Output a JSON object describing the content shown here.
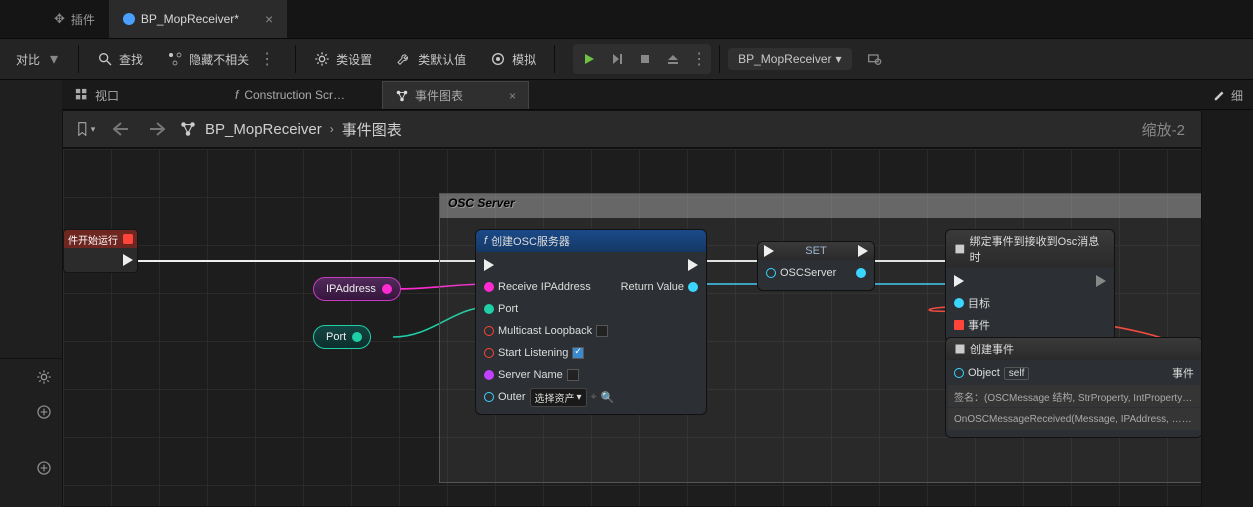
{
  "tabs": {
    "plugin": "插件",
    "bp": "BP_MopReceiver*"
  },
  "toolbar": {
    "compare": "对比",
    "find": "查找",
    "hide_unrelated": "隐藏不相关",
    "class_settings": "类设置",
    "class_defaults": "类默认值",
    "simulate": "模拟",
    "bp_name": "BP_MopReceiver"
  },
  "sub_tabs": {
    "viewport": "视口",
    "construction": "Construction Scr…",
    "event_graph": "事件图表",
    "detail": "细"
  },
  "crumb": {
    "bp": "BP_MopReceiver",
    "graph": "事件图表",
    "zoom": "缩放-2"
  },
  "graph": {
    "comment_title": "OSC Server",
    "event_start": "件开始运行",
    "var_ip": "IPAddress",
    "var_port": "Port",
    "node_create": {
      "title": "创建OSC服务器",
      "receive_ip": "Receive IPAddress",
      "port": "Port",
      "multicast": "Multicast Loopback",
      "start_listen": "Start Listening",
      "server_name": "Server Name",
      "outer": "Outer",
      "outer_drop": "选择资产",
      "return": "Return Value"
    },
    "node_set": {
      "title": "SET",
      "var": "OSCServer"
    },
    "node_bind": {
      "title": "绑定事件到接收到Osc消息时",
      "target": "目标",
      "event": "事件"
    },
    "node_create_event": {
      "title": "创建事件",
      "object": "Object",
      "self": "self",
      "event": "事件",
      "sig": "签名：(OSCMessage 结构, StrProperty, IntProperty) -> …",
      "fn": "OnOSCMessageReceived(Message, IPAddress, …) -> …"
    }
  }
}
